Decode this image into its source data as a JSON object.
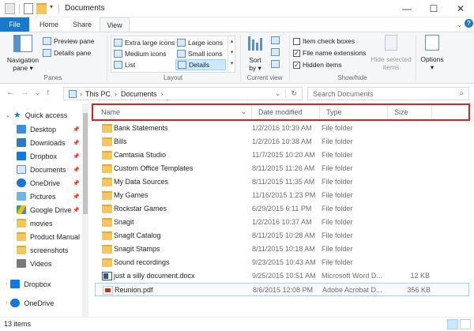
{
  "window": {
    "title": "Documents"
  },
  "tabs": [
    {
      "label": "File"
    },
    {
      "label": "Home"
    },
    {
      "label": "Share"
    },
    {
      "label": "View"
    }
  ],
  "ribbon": {
    "panes": {
      "label": "Panes",
      "navigation_pane": "Navigation",
      "navigation_pane_sub": "pane ▾",
      "preview_pane": "Preview pane",
      "details_pane": "Details pane"
    },
    "layout": {
      "label": "Layout",
      "items": [
        "Extra large icons",
        "Large icons",
        "Medium icons",
        "Small icons",
        "List",
        "Details"
      ],
      "selected": "Details"
    },
    "current_view": {
      "label": "Current view",
      "sort_by": "Sort",
      "sort_by_sub": "by ▾"
    },
    "show_hide": {
      "label": "Show/hide",
      "item_check_boxes": "Item check boxes",
      "file_name_extensions": "File name extensions",
      "hidden_items": "Hidden items",
      "hide_selected": "Hide selected",
      "hide_selected_sub": "items"
    },
    "options": {
      "label": "Options",
      "label_sub": "▾"
    }
  },
  "address": {
    "crumbs": [
      "This PC",
      "Documents"
    ],
    "search_placeholder": "Search Documents"
  },
  "nav": {
    "quick_access": "Quick access",
    "items": [
      {
        "label": "Desktop",
        "pinned": true
      },
      {
        "label": "Downloads",
        "pinned": true
      },
      {
        "label": "Dropbox",
        "pinned": true
      },
      {
        "label": "Documents",
        "pinned": true
      },
      {
        "label": "OneDrive",
        "pinned": true
      },
      {
        "label": "Pictures",
        "pinned": true
      },
      {
        "label": "Google Drive",
        "pinned": true
      },
      {
        "label": "movies",
        "pinned": false
      },
      {
        "label": "Product Manual",
        "pinned": false
      },
      {
        "label": "screenshots",
        "pinned": false
      },
      {
        "label": "Videos",
        "pinned": false
      }
    ],
    "roots": [
      "Dropbox",
      "OneDrive"
    ]
  },
  "columns": {
    "name": "Name",
    "date": "Date modified",
    "type": "Type",
    "size": "Size"
  },
  "files": [
    {
      "name": "Bank Statements",
      "date": "1/2/2016 10:39 AM",
      "type": "File folder",
      "size": "",
      "icon": "folder-icon"
    },
    {
      "name": "Bills",
      "date": "1/2/2016 10:38 AM",
      "type": "File folder",
      "size": "",
      "icon": "folder-icon"
    },
    {
      "name": "Camtasia Studio",
      "date": "11/7/2015 10:20 AM",
      "type": "File folder",
      "size": "",
      "icon": "folder-icon"
    },
    {
      "name": "Custom Office Templates",
      "date": "8/11/2015 11:26 AM",
      "type": "File folder",
      "size": "",
      "icon": "folder-icon"
    },
    {
      "name": "My Data Sources",
      "date": "8/11/2015 11:35 AM",
      "type": "File folder",
      "size": "",
      "icon": "folder-icon"
    },
    {
      "name": "My Games",
      "date": "11/16/2015 1:23 PM",
      "type": "File folder",
      "size": "",
      "icon": "folder-icon"
    },
    {
      "name": "Rockstar Games",
      "date": "6/29/2015 6:11 PM",
      "type": "File folder",
      "size": "",
      "icon": "folder-icon"
    },
    {
      "name": "Snagit",
      "date": "1/2/2016 10:37 AM",
      "type": "File folder",
      "size": "",
      "icon": "folder-icon"
    },
    {
      "name": "SnagIt Catalog",
      "date": "8/11/2015 10:28 AM",
      "type": "File folder",
      "size": "",
      "icon": "folder-icon"
    },
    {
      "name": "Snagit Stamps",
      "date": "8/11/2015 10:18 AM",
      "type": "File folder",
      "size": "",
      "icon": "folder-icon"
    },
    {
      "name": "Sound recordings",
      "date": "9/23/2015 10:43 AM",
      "type": "File folder",
      "size": "",
      "icon": "folder-icon"
    },
    {
      "name": "just a silly document.docx",
      "date": "9/25/2015 10:51 AM",
      "type": "Microsoft Word D...",
      "size": "12 KB",
      "icon": "word-doc-icon"
    },
    {
      "name": "Reunion.pdf",
      "date": "8/6/2015 12:08 PM",
      "type": "Adobe Acrobat D...",
      "size": "356 KB",
      "icon": "pdf-icon"
    }
  ],
  "status": {
    "count": "13 items"
  }
}
